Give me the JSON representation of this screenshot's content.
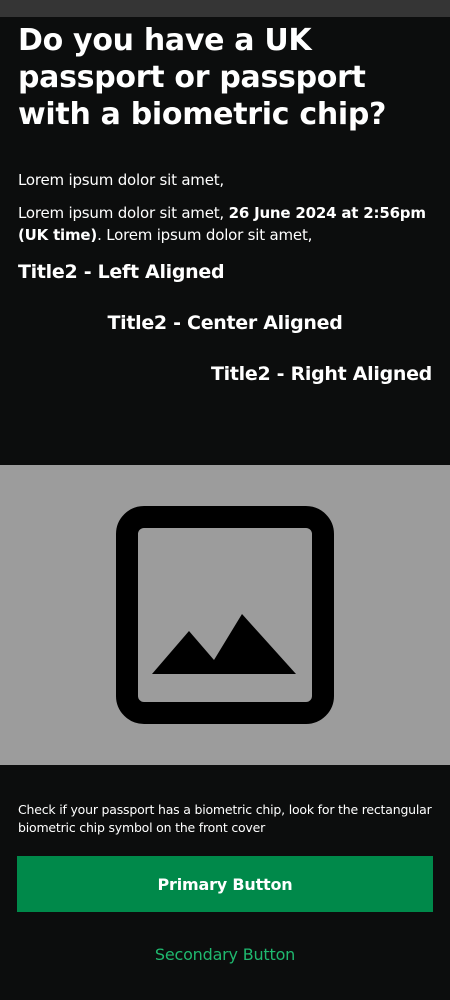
{
  "title": "Do you have a UK passport or passport with a biometric chip?",
  "paragraph1": "Lorem ipsum dolor sit amet,",
  "paragraph2": {
    "before": "Lorem ipsum dolor sit amet, ",
    "bold": "26 June 2024 at 2:56pm (UK time)",
    "after": ". Lorem ipsum dolor sit amet,"
  },
  "title2_left": "Title2 - Left Aligned",
  "title2_center": "Title2 - Center Aligned",
  "title2_right": "Title2 - Right Aligned",
  "image": {
    "icon": "image-placeholder-icon"
  },
  "helper_text": "Check if your passport has a biometric chip, look for the rectangular biometric chip symbol on the front cover",
  "primary_button": "Primary Button",
  "secondary_button": "Secondary Button",
  "colors": {
    "background": "#0c0d0d",
    "image_panel": "#9c9c9c",
    "primary": "#00894a",
    "secondary_text": "#1fb86f"
  }
}
